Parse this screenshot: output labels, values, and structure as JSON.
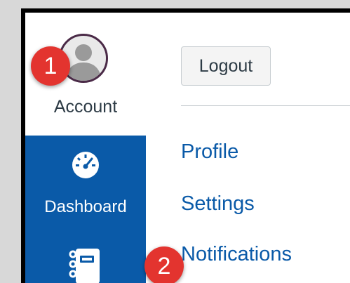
{
  "nav": {
    "account_label": "Account",
    "dashboard_label": "Dashboard"
  },
  "tray": {
    "logout_label": "Logout",
    "links": [
      "Profile",
      "Settings",
      "Notifications"
    ]
  },
  "callouts": [
    "1",
    "2"
  ],
  "colors": {
    "nav_blue": "#0a5aa8",
    "link_blue": "#0a5aa8",
    "callout_red": "#e3342f",
    "avatar_ring": "#4a2a47"
  },
  "icons": {
    "account": "user-avatar-icon",
    "dashboard": "speedometer-icon",
    "courses": "notebook-icon"
  }
}
